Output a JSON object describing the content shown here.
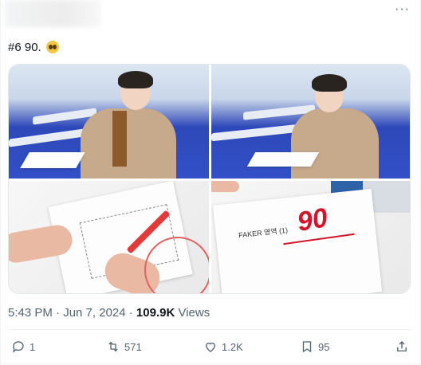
{
  "tweet": {
    "text": "#6 90.",
    "emoji_icon": "pleading-face-emoji",
    "timestamp": "5:43 PM · Jun 7, 2024 · ",
    "views_count": "109.9K",
    "views_label": " Views"
  },
  "images": {
    "sheet_name": "FAKER 영역 (1)",
    "score_mark": "90"
  },
  "actions": {
    "replies": "1",
    "retweets": "571",
    "likes": "1.2K",
    "bookmarks": "95"
  },
  "colors": {
    "accent_red": "#d4142a",
    "muted": "#536471"
  }
}
